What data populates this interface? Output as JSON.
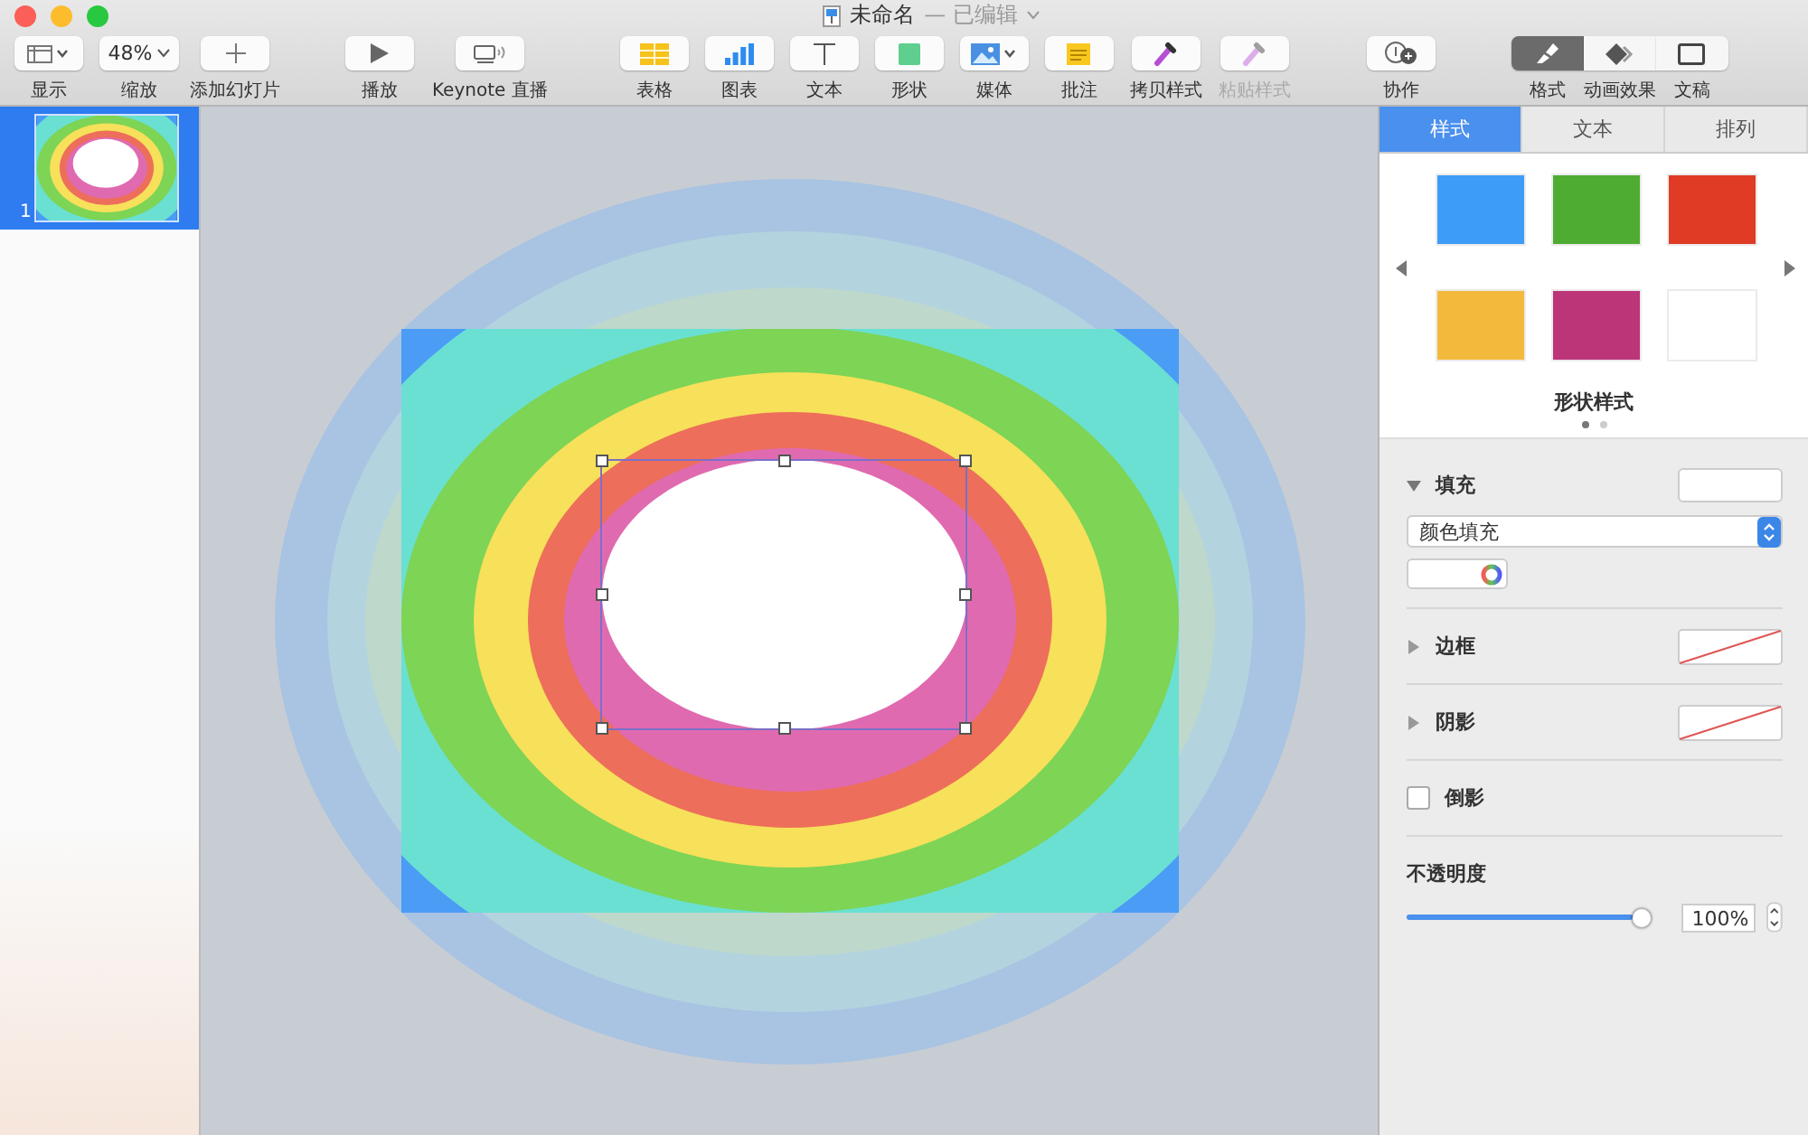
{
  "window": {
    "title": "未命名",
    "status": "— 已编辑"
  },
  "toolbar": {
    "left": [
      {
        "kind": "view",
        "label": "显示"
      },
      {
        "kind": "zoom",
        "value": "48%",
        "label": "缩放"
      },
      {
        "kind": "add",
        "label": "添加幻灯片"
      }
    ],
    "play": [
      {
        "kind": "play",
        "label": "播放"
      },
      {
        "kind": "live",
        "label": "Keynote 直播"
      }
    ],
    "insert": [
      {
        "kind": "table",
        "label": "表格",
        "disabled": false
      },
      {
        "kind": "chart",
        "label": "图表",
        "disabled": false
      },
      {
        "kind": "text",
        "label": "文本",
        "disabled": false
      },
      {
        "kind": "shape",
        "label": "形状",
        "disabled": false
      },
      {
        "kind": "media",
        "label": "媒体",
        "disabled": false
      },
      {
        "kind": "comment",
        "label": "批注",
        "disabled": false
      },
      {
        "kind": "copy",
        "label": "拷贝样式",
        "disabled": false
      },
      {
        "kind": "paste",
        "label": "粘贴样式",
        "disabled": true
      }
    ],
    "collab": {
      "label": "协作"
    },
    "panels": [
      {
        "kind": "format",
        "label": "格式",
        "selected": true
      },
      {
        "kind": "animate",
        "label": "动画效果",
        "selected": false
      },
      {
        "kind": "document",
        "label": "文稿",
        "selected": false
      }
    ]
  },
  "slides": [
    {
      "number": "1",
      "selected": true
    }
  ],
  "inspector": {
    "tabs": [
      {
        "label": "样式",
        "selected": true
      },
      {
        "label": "文本",
        "selected": false
      },
      {
        "label": "排列",
        "selected": false
      }
    ],
    "styles": [
      {
        "color": "#3d9cf7"
      },
      {
        "color": "#4fac33"
      },
      {
        "color": "#e03b24"
      },
      {
        "color": "#f3b93d"
      },
      {
        "color": "#bc3579"
      },
      {
        "color": "#ffffff"
      }
    ],
    "styles_title": "形状样式",
    "pages": [
      {
        "selected": true
      },
      {
        "selected": false
      }
    ],
    "fill": {
      "label": "填充",
      "expanded": true,
      "type": "颜色填充"
    },
    "border": {
      "label": "边框",
      "expanded": false
    },
    "shadow": {
      "label": "阴影",
      "expanded": false
    },
    "reflection": {
      "label": "倒影",
      "checked": false
    },
    "opacity": {
      "label": "不透明度",
      "level": 0.97,
      "reading": "100%"
    }
  }
}
